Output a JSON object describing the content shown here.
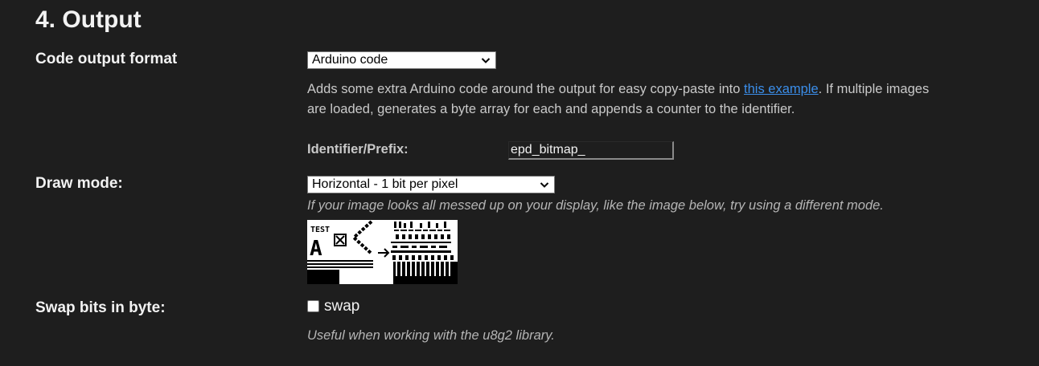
{
  "section": {
    "title": "4. Output"
  },
  "code_output": {
    "label": "Code output format",
    "selected": "Arduino code",
    "description_before_link": "Adds some extra Arduino code around the output for easy copy-paste into ",
    "link_text": "this example",
    "description_after_link": ". If multiple images are loaded, generates a byte array for each and appends a counter to the identifier.",
    "identifier_label": "Identifier/Prefix:",
    "identifier_value": "epd_bitmap_"
  },
  "draw_mode": {
    "label": "Draw mode:",
    "selected": "Horizontal - 1 bit per pixel",
    "hint": "If your image looks all messed up on your display, like the image below, try using a different mode.",
    "preview_text": "TEST",
    "preview_glyph": "A"
  },
  "swap_bits": {
    "label": "Swap bits in byte:",
    "checkbox_label": "swap",
    "checked": false,
    "hint": "Useful when working with the u8g2 library."
  },
  "colors": {
    "background": "#1e1e1e",
    "link": "#3b8eea",
    "text": "#f2f2f2",
    "muted": "#c9c9c9"
  }
}
